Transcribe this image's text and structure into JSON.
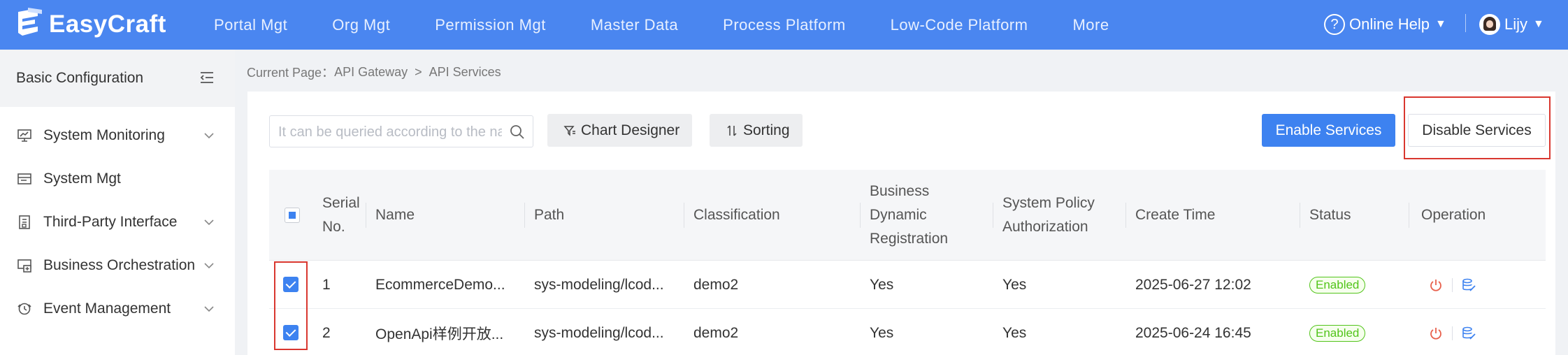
{
  "app": {
    "name": "EasyCraft"
  },
  "colors": {
    "header": "#4a86f0",
    "primary": "#3d82f0",
    "success": "#52c41a",
    "danger": "#e8604c",
    "highlight": "#d9372f"
  },
  "nav": [
    "Portal Mgt",
    "Org Mgt",
    "Permission Mgt",
    "Master Data",
    "Process Platform",
    "Low-Code Platform",
    "More"
  ],
  "header": {
    "help_label": "Online Help",
    "user_name": "Lijy"
  },
  "sidebar": {
    "title": "Basic Configuration",
    "items": [
      {
        "label": "System Monitoring",
        "icon": "monitor-icon",
        "expandable": true
      },
      {
        "label": "System Mgt",
        "icon": "window-icon",
        "expandable": false
      },
      {
        "label": "Third-Party Interface",
        "icon": "interface-icon",
        "expandable": true
      },
      {
        "label": "Business Orchestration",
        "icon": "orchestration-icon",
        "expandable": true
      },
      {
        "label": "Event Management",
        "icon": "event-icon",
        "expandable": true
      }
    ]
  },
  "breadcrumb": {
    "prefix": "Current Page：",
    "items": [
      "API Gateway",
      "API Services"
    ],
    "separator": ">"
  },
  "toolbar": {
    "search_placeholder": "It can be queried according to the name",
    "chart_designer": "Chart Designer",
    "sorting": "Sorting",
    "enable": "Enable Services",
    "disable": "Disable Services"
  },
  "table": {
    "headers": {
      "serial_1": "Serial",
      "serial_2": "No.",
      "name": "Name",
      "path": "Path",
      "classification": "Classification",
      "bdr_1": "Business",
      "bdr_2": "Dynamic",
      "bdr_3": "Registration",
      "spa_1": "System Policy",
      "spa_2": "Authorization",
      "create_time": "Create Time",
      "status": "Status",
      "operation": "Operation"
    },
    "rows": [
      {
        "no": "1",
        "name": "EcommerceDemo...",
        "path": "sys-modeling/lcod...",
        "classification": "demo2",
        "bdr": "Yes",
        "spa": "Yes",
        "create_time": "2025-06-27 12:02",
        "status": "Enabled",
        "checked": true
      },
      {
        "no": "2",
        "name": "OpenApi样例开放...",
        "path": "sys-modeling/lcod...",
        "classification": "demo2",
        "bdr": "Yes",
        "spa": "Yes",
        "create_time": "2025-06-24 16:45",
        "status": "Enabled",
        "checked": true
      }
    ]
  }
}
